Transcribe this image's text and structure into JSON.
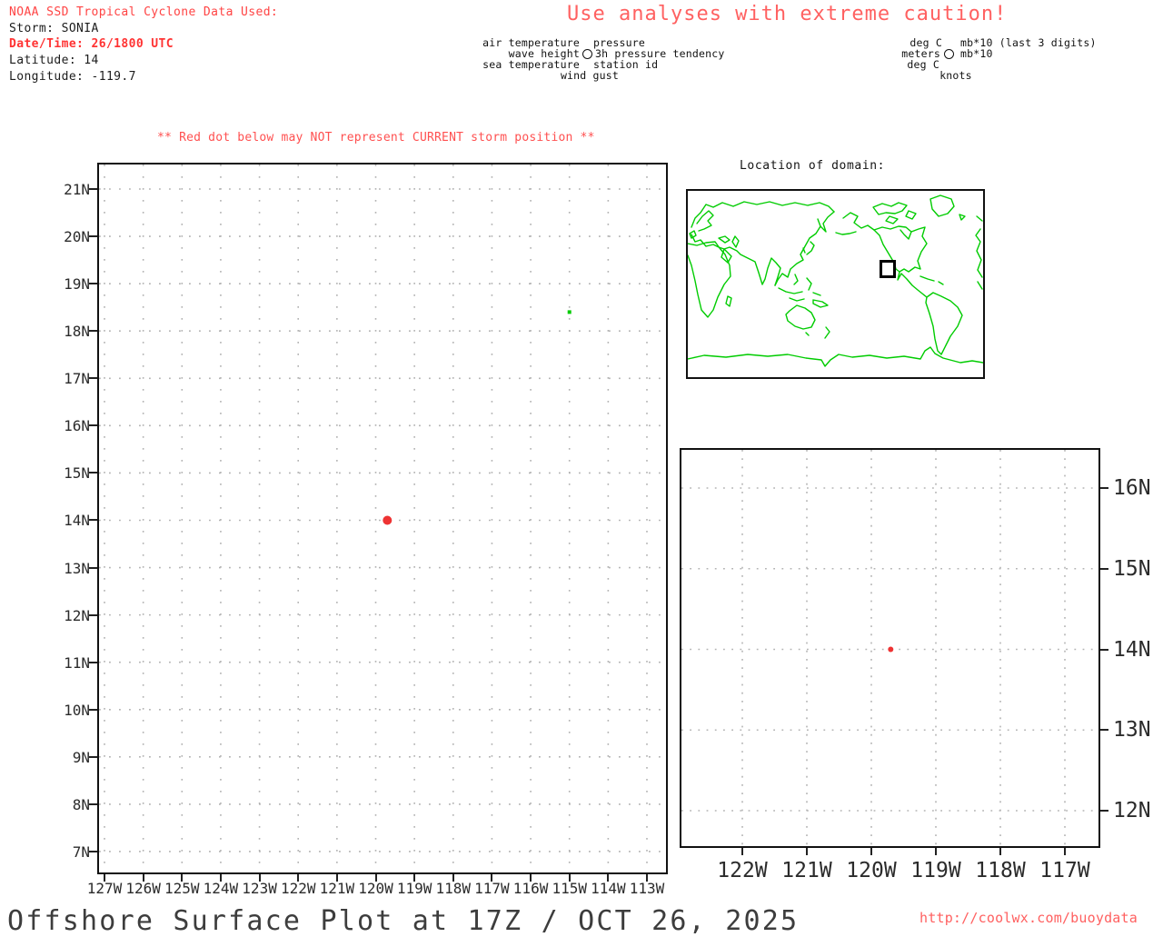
{
  "header": {
    "source_line": "NOAA SSD Tropical Cyclone Data Used:",
    "storm_line": "Storm: SONIA",
    "datetime_line": "Date/Time: 26/1800 UTC",
    "latitude_line": "Latitude: 14",
    "longitude_line": "Longitude: -119.7"
  },
  "caution_banner": "Use analyses with extreme caution!",
  "storm_warning": "** Red dot below may NOT represent CURRENT storm position **",
  "station_model_legend": {
    "top_left": "air temperature",
    "top_right": "pressure",
    "mid_left": "wave height",
    "mid_right": "3h pressure tendency",
    "bottom_left": "sea temperature",
    "bottom_right": "station id",
    "bottom_center": "wind gust"
  },
  "units_legend": {
    "top_left": "deg C",
    "top_right": "mb*10 (last 3 digits)",
    "mid_left": "meters",
    "mid_right": "mb*10",
    "bottom_left": "deg C",
    "bottom_center": "knots"
  },
  "domain_map": {
    "title": "Location of domain:"
  },
  "footer": {
    "title": "Offshore Surface Plot at 17Z / OCT 26, 2025",
    "url": "http://coolwx.com/buoydata"
  },
  "colors": {
    "header_red": "#ff4444",
    "datetime_red": "#ff3333",
    "caution_red": "#ff6161",
    "warning_red": "#ff5050",
    "url_red": "#ff6060",
    "storm_dot_red": "#ee3333",
    "coastline_green": "#00cc00",
    "grid_gray": "#b3b3b3",
    "title_gray": "#3d3d3d"
  },
  "chart_data": [
    {
      "type": "scatter",
      "name": "main-surface-plot",
      "grid": "dotted",
      "x_tick_values": [
        -127,
        -126,
        -125,
        -124,
        -123,
        -122,
        -121,
        -120,
        -119,
        -118,
        -117,
        -116,
        -115,
        -114,
        -113
      ],
      "x_tick_labels": [
        "127W",
        "126W",
        "125W",
        "124W",
        "123W",
        "122W",
        "121W",
        "120W",
        "119W",
        "118W",
        "117W",
        "116W",
        "115W",
        "114W",
        "113W"
      ],
      "y_tick_values": [
        21,
        20,
        19,
        18,
        17,
        16,
        15,
        14,
        13,
        12,
        11,
        10,
        9,
        8,
        7
      ],
      "y_tick_labels": [
        "21N",
        "20N",
        "19N",
        "18N",
        "17N",
        "16N",
        "15N",
        "14N",
        "13N",
        "12N",
        "11N",
        "10N",
        "9N",
        "8N",
        "7N"
      ],
      "xlim": [
        -127.15,
        -112.5
      ],
      "ylim": [
        6.5,
        21.55
      ],
      "points": [
        {
          "name": "storm-position-dot",
          "lon": -119.7,
          "lat": 14,
          "color": "#ee3333",
          "r": 5,
          "shape": "circle"
        },
        {
          "name": "station-mark-green",
          "lon": -115.0,
          "lat": 18.4,
          "color": "#00cc00",
          "r": 2,
          "shape": "square"
        }
      ]
    },
    {
      "type": "scatter",
      "name": "zoom-surface-plot",
      "grid": "dotted",
      "x_tick_values": [
        -122,
        -121,
        -120,
        -119,
        -118,
        -117
      ],
      "x_tick_labels": [
        "122W",
        "121W",
        "120W",
        "119W",
        "118W",
        "117W"
      ],
      "y_tick_values": [
        16,
        15,
        14,
        13,
        12
      ],
      "y_tick_labels": [
        "16N",
        "15N",
        "14N",
        "13N",
        "12N"
      ],
      "xlim": [
        -122.95,
        -116.5
      ],
      "ylim": [
        11.55,
        16.5
      ],
      "points": [
        {
          "name": "storm-position-dot",
          "lon": -119.7,
          "lat": 14,
          "color": "#ee3333",
          "r": 3,
          "shape": "circle"
        }
      ]
    }
  ]
}
